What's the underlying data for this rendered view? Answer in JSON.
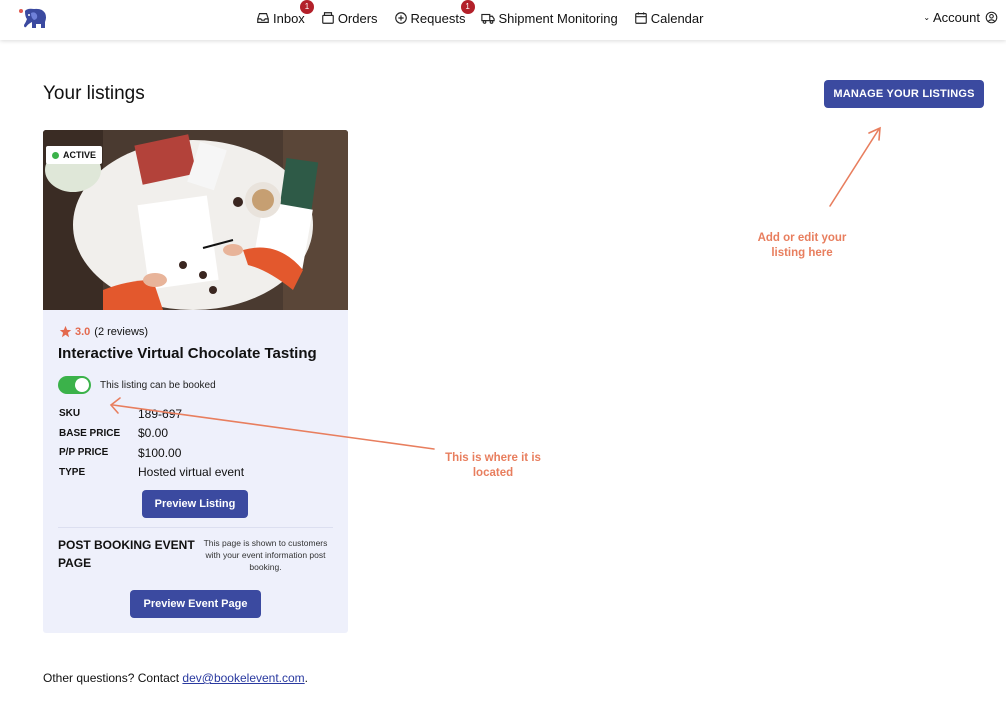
{
  "nav": {
    "items": [
      {
        "label": "Inbox",
        "icon": "inbox-icon",
        "badge": "1"
      },
      {
        "label": "Orders",
        "icon": "orders-icon",
        "badge": ""
      },
      {
        "label": "Requests",
        "icon": "plus-circle-icon",
        "badge": "1"
      },
      {
        "label": "Shipment Monitoring",
        "icon": "truck-icon",
        "badge": ""
      },
      {
        "label": "Calendar",
        "icon": "calendar-icon",
        "badge": ""
      }
    ],
    "account_label": "Account"
  },
  "page": {
    "title": "Your listings",
    "manage_button": "MANAGE YOUR LISTINGS"
  },
  "listing": {
    "status": "ACTIVE",
    "rating": "3.0",
    "reviews": "(2 reviews)",
    "title": "Interactive Virtual Chocolate Tasting",
    "bookable_label": "This listing can be booked",
    "bookable": true,
    "details": [
      {
        "label": "SKU",
        "value": "189-697"
      },
      {
        "label": "BASE PRICE",
        "value": "$0.00"
      },
      {
        "label": "P/P PRICE",
        "value": "$100.00"
      },
      {
        "label": "TYPE",
        "value": "Hosted virtual event"
      }
    ],
    "preview_button": "Preview Listing",
    "post_booking_title": "POST BOOKING EVENT PAGE",
    "post_booking_desc": "This page is shown to customers with your event information post booking.",
    "preview_event_button": "Preview Event Page"
  },
  "annotations": {
    "manage_note": "Add or edit your listing here",
    "toggle_note": "This is where it is located"
  },
  "footer": {
    "text": "Other questions? Contact",
    "email": "dev@bookelevent.com",
    "end": "."
  },
  "colors": {
    "primary": "#3b4aa0",
    "badge": "#b3202a",
    "active": "#3bb24a",
    "annotation": "#e87e5e",
    "card_bg": "#eef0fb"
  }
}
